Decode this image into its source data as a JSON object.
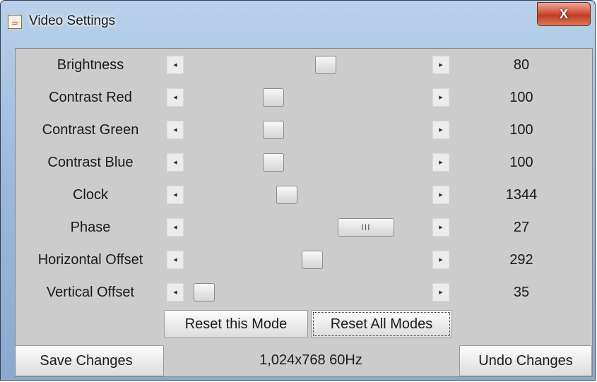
{
  "window": {
    "title": "Video Settings",
    "close_label": "X",
    "icon": "java-cup-icon"
  },
  "settings": [
    {
      "label": "Brightness",
      "value": "80",
      "position": 0.578
    },
    {
      "label": "Contrast Red",
      "value": "100",
      "position": 0.348
    },
    {
      "label": "Contrast Green",
      "value": "100",
      "position": 0.348
    },
    {
      "label": "Contrast Blue",
      "value": "100",
      "position": 0.348
    },
    {
      "label": "Clock",
      "value": "1344",
      "position": 0.408
    },
    {
      "label": "Phase",
      "value": "27",
      "position": 0.8
    },
    {
      "label": "Horizontal Offset",
      "value": "292",
      "position": 0.518
    },
    {
      "label": "Vertical Offset",
      "value": "35",
      "position": 0.045
    }
  ],
  "phase_thumb_grip": "III",
  "buttons": {
    "reset_mode": "Reset this Mode",
    "reset_all": "Reset All Modes",
    "save": "Save Changes",
    "undo": "Undo Changes"
  },
  "status": {
    "mode": "1,024x768 60Hz"
  }
}
